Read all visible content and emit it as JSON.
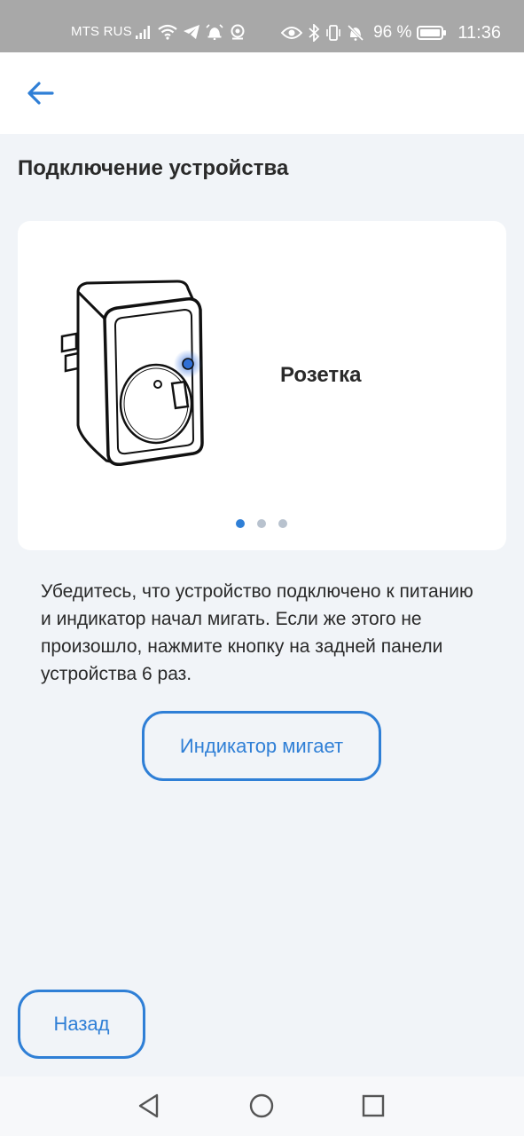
{
  "status_bar": {
    "carrier": "MTS RUS",
    "battery_percent": "96 %",
    "time": "11:36",
    "icons": [
      "signal-icon",
      "wifi-icon",
      "telegram-icon",
      "alarm-icon",
      "camera-icon",
      "eye-icon",
      "bluetooth-icon",
      "vibrate-icon",
      "mute-icon",
      "battery-icon"
    ]
  },
  "header": {
    "back_icon": "arrow-left-icon"
  },
  "page": {
    "title": "Подключение устройства"
  },
  "carousel": {
    "device_name": "Розетка",
    "slide_count": 3,
    "active_slide": 1,
    "indicator_light_color": "#2f6fd6"
  },
  "instruction_text": "Убедитесь, что устройство подключено к питанию и индикатор начал мигать. Если же этого не произошло, нажмите кнопку на задней панели устройства 6 раз.",
  "buttons": {
    "indicator_blinking": "Индикатор мигает",
    "back": "Назад"
  },
  "colors": {
    "accent": "#2f7fd6",
    "background": "#f1f4f8",
    "card": "#ffffff",
    "status_bar": "#a8a8a8"
  },
  "nav_bar": {
    "icons": [
      "back-triangle-icon",
      "home-circle-icon",
      "recents-square-icon"
    ]
  }
}
